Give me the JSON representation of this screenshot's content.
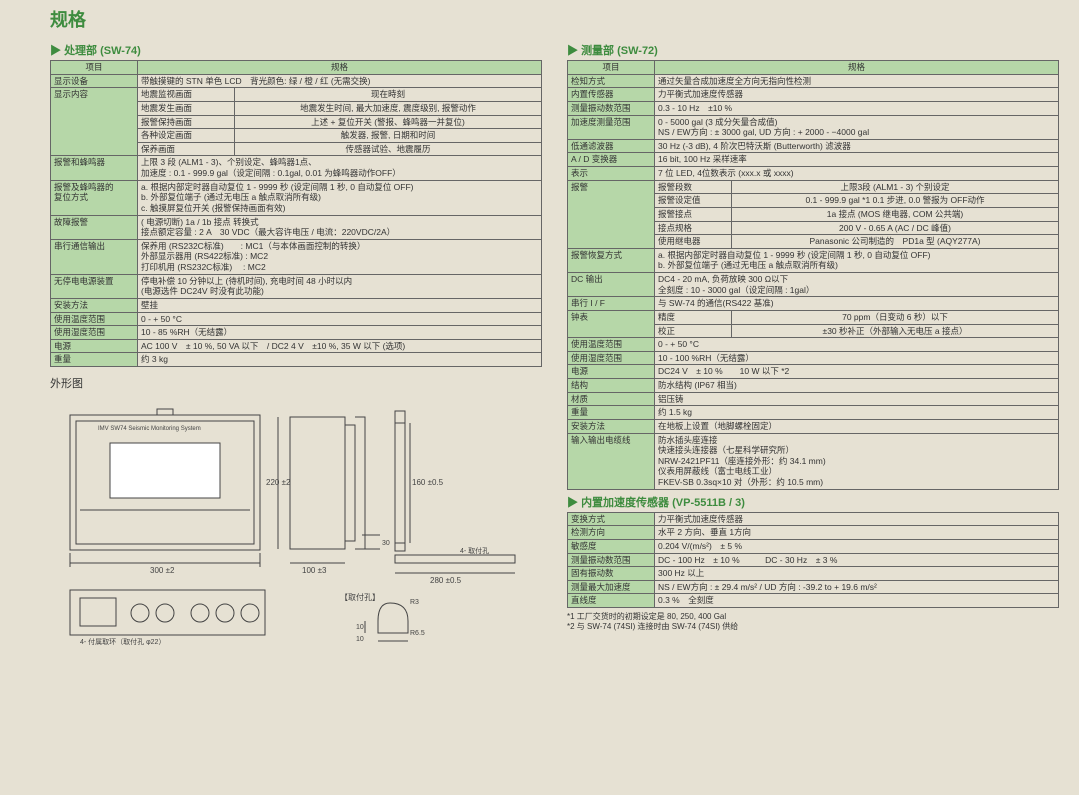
{
  "title": "规格",
  "left": {
    "sectionTitle": "处理部 (SW-74)",
    "headers": {
      "item": "项目",
      "spec": "规格"
    },
    "rows": [
      {
        "k": "显示设备",
        "v": "带触摸键的 STN 单色 LCD　背光颜色: 绿 / 橙 / 红 (无需交换)"
      },
      {
        "k": "显示内容",
        "sub": [
          {
            "a": "地震监视画面",
            "b": "现在時刻"
          },
          {
            "a": "地震发生画面",
            "b": "地震发生时间, 最大加速度, 震度级别, 报警动作"
          },
          {
            "a": "报警保持画面",
            "b": "上述 + 复位开关 (警报、蜂鸣器一并复位)"
          },
          {
            "a": "各种设定画面",
            "b": "触发器, 报警, 日期和时间"
          },
          {
            "a": "保养画面",
            "b": "传感器试验、地震履历"
          }
        ]
      },
      {
        "k": "报警和蜂鸣器",
        "v": "上限 3 段 (ALM1 - 3)、个别设定、蜂鸣器1点、\n加速度 : 0.1 - 999.9 gal（设定间隔 : 0.1gal, 0.01 为蜂鸣器动作OFF）"
      },
      {
        "k": "报警及蜂鸣器的\n复位方式",
        "v": "a. 根据内部定时器自动复位 1 - 9999 秒 (设定间隔 1 秒, 0 自动复位 OFF)\nb. 外部复位端子 (通过无电压 a 触点取消所有级)\nc. 触摸屏复位开关 (报警保持画面有效)"
      },
      {
        "k": "故障报警",
        "v": "( 电源切断) 1a / 1b 接点 转换式\n接点额定容量 : 2 A　30 VDC（最大容许电压 / 电流：220VDC/2A）"
      },
      {
        "k": "串行通信输出",
        "v": "保养用 (RS232C标准)　　: MC1（与本体画面控制的转换）\n外部显示器用 (RS422标准) : MC2\n打印机用 (RS232C标准)　 : MC2"
      },
      {
        "k": "无停电电源装置",
        "v": "停电补偿 10 分钟以上 (待机时间), 充电时间 48 小时以内\n(电源选件 DC24V 时没有此功能)"
      },
      {
        "k": "安装方法",
        "v": "壁挂"
      },
      {
        "k": "使用温度范围",
        "v": "0  - + 50 °C"
      },
      {
        "k": "使用湿度范围",
        "v": "10 - 85 %RH（无结露）"
      },
      {
        "k": "电源",
        "v": "AC 100 V　± 10 %, 50 VA 以下　/ DC2 4 V　±10 %, 35 W 以下 (选项)"
      },
      {
        "k": "重量",
        "v": "约 3 kg"
      }
    ],
    "outlineLabel": "外形图"
  },
  "right": {
    "sectionA": "测量部 (SW-72)",
    "headersA": {
      "item": "项目",
      "spec": "规格"
    },
    "rowsA": [
      {
        "k": "检知方式",
        "v": "通过矢量合成加速度全方向无指向性检测"
      },
      {
        "k": "内置传感器",
        "v": "力平衡式加速度传感器"
      },
      {
        "k": "测量振动数范围",
        "v": "0.3 - 10 Hz　±10 %"
      },
      {
        "k": "加速度测量范围",
        "v": "0 - 5000 gal (3 成分矢量合成值)\nNS / EW方向 : ± 3000 gal, UD 方向 : + 2000 - −4000 gal"
      },
      {
        "k": "低通滤波器",
        "v": "30 Hz (-3 dB), 4 阶次巴特沃斯 (Butterworth) 滤波器"
      },
      {
        "k": "A / D 变换器",
        "v": "16 bit, 100 Hz 采样速率"
      },
      {
        "k": "表示",
        "v": "7 位 LED, 4位数表示 (xxx.x 或 xxxx)"
      },
      {
        "k": "报警",
        "sub": [
          {
            "a": "报警段数",
            "b": "上限3段 (ALM1 - 3) 个别设定"
          },
          {
            "a": "报警设定值",
            "b": "0.1 - 999.9 gal *1 0.1 步进, 0.0 警报为 OFF动作"
          },
          {
            "a": "报警接点",
            "b": "1a 接点 (MOS 继电器, COM 公共端)"
          },
          {
            "a": "接点规格",
            "b": "200 V - 0.65 A (AC / DC 峰值)"
          },
          {
            "a": "使用继电器",
            "b": "Panasonic 公司制造的　PD1a 型 (AQY277A)"
          }
        ]
      },
      {
        "k": "报警恢复方式",
        "v": "a. 根据内部定时器自动复位 1 - 9999 秒 (设定间隔 1 秒, 0 自动复位 OFF)\nb. 外部复位端子 (通过无电压 a 触点取消所有级)"
      },
      {
        "k": "DC 输出",
        "v": "DC4 - 20 mA, 负荷放映 300 Ω以下\n全刻度 : 10 - 3000 gal（设定间隔 : 1gal）"
      },
      {
        "k": "串行 I / F",
        "v": "与 SW-74 的通信(RS422 基准)"
      },
      {
        "k": "钟表",
        "sub": [
          {
            "a": "精度",
            "b": "70 ppm（日变动 6 秒）以下"
          },
          {
            "a": "校正",
            "b": "±30 秒补正（外部输入无电压 a 接点）"
          }
        ]
      },
      {
        "k": "使用温度范围",
        "v": "0  - + 50 °C"
      },
      {
        "k": "使用湿度范围",
        "v": "10 - 100 %RH（无结露）"
      },
      {
        "k": "电源",
        "v": "DC24 V　± 10 %　　10 W 以下 *2"
      },
      {
        "k": "结构",
        "v": "防水结构 (IP67 相当)"
      },
      {
        "k": "材质",
        "v": "铝压铸"
      },
      {
        "k": "重量",
        "v": "约 1.5 kg"
      },
      {
        "k": "安装方法",
        "v": "在地板上设置（地脚螺栓固定）"
      },
      {
        "k": "输入输出电缆线",
        "v": "防水插头座连接\n快速接头连接器（七星科学研究所）\nNRW-2421PF11（座连接外形：约 34.1 mm)\n仪表用屏蔽线（富士电线工业）\nFKEV-SB 0.3sq×10 对（外形：约 10.5 mm)"
      }
    ],
    "sectionB": "内置加速度传感器 (VP-5511B / 3)",
    "rowsB": [
      {
        "k": "变换方式",
        "v": "力平衡式加速度传感器"
      },
      {
        "k": "检测方向",
        "v": "水平 2 方向、垂直 1方向"
      },
      {
        "k": "敏感度",
        "v": "0.204 V/(m/s²)　± 5 %"
      },
      {
        "k": "测量振动数范围",
        "v": "DC - 100 Hz　± 10 %　　　DC - 30 Hz　± 3 %"
      },
      {
        "k": "固有振动数",
        "v": "300 Hz 以上"
      },
      {
        "k": "测量最大加速度",
        "v": "NS / EW方向 : ± 29.4 m/s²  / UD 方向 : -39.2 to + 19.6 m/s²"
      },
      {
        "k": "直线度",
        "v": "0.3 %　全刻度"
      }
    ],
    "footnotes": "*1 工厂交货时的初期设定是 80, 250, 400 Gal\n*2 与 SW-74 (74SI) 连接时由 SW-74 (74SI) 供给"
  }
}
